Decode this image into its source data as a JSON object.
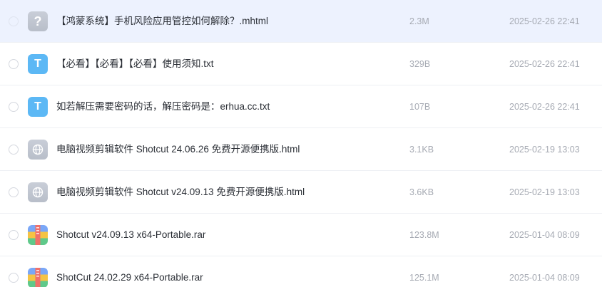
{
  "files": [
    {
      "name": "【鸿蒙系统】手机风险应用管控如何解除？.mhtml",
      "size": "2.3M",
      "date": "2025-02-26 22:41",
      "icon": "unknown-file-icon",
      "glyph": "?",
      "selected": true
    },
    {
      "name": "【必看】【必看】【必看】使用须知.txt",
      "size": "329B",
      "date": "2025-02-26 22:41",
      "icon": "text-file-icon",
      "glyph": "T",
      "selected": false
    },
    {
      "name": "如若解压需要密码的话，解压密码是：erhua.cc.txt",
      "size": "107B",
      "date": "2025-02-26 22:41",
      "icon": "text-file-icon",
      "glyph": "T",
      "selected": false
    },
    {
      "name": "电脑视频剪辑软件 Shotcut 24.06.26 免费开源便携版.html",
      "size": "3.1KB",
      "date": "2025-02-19 13:03",
      "icon": "web-file-icon",
      "glyph": "",
      "selected": false
    },
    {
      "name": "电脑视频剪辑软件 Shotcut v24.09.13 免费开源便携版.html",
      "size": "3.6KB",
      "date": "2025-02-19 13:03",
      "icon": "web-file-icon",
      "glyph": "",
      "selected": false
    },
    {
      "name": "Shotcut v24.09.13 x64-Portable.rar",
      "size": "123.8M",
      "date": "2025-01-04 08:09",
      "icon": "archive-file-icon",
      "glyph": "",
      "selected": false
    },
    {
      "name": "ShotCut 24.02.29 x64-Portable.rar",
      "size": "125.1M",
      "date": "2025-01-04 08:09",
      "icon": "archive-file-icon",
      "glyph": "",
      "selected": false
    }
  ],
  "colors": {
    "selected_row": "#edf2fe",
    "text_icon": "#5cb8f5",
    "neutral_icon": "#bfc4ce",
    "meta_text": "#a6aab3"
  }
}
